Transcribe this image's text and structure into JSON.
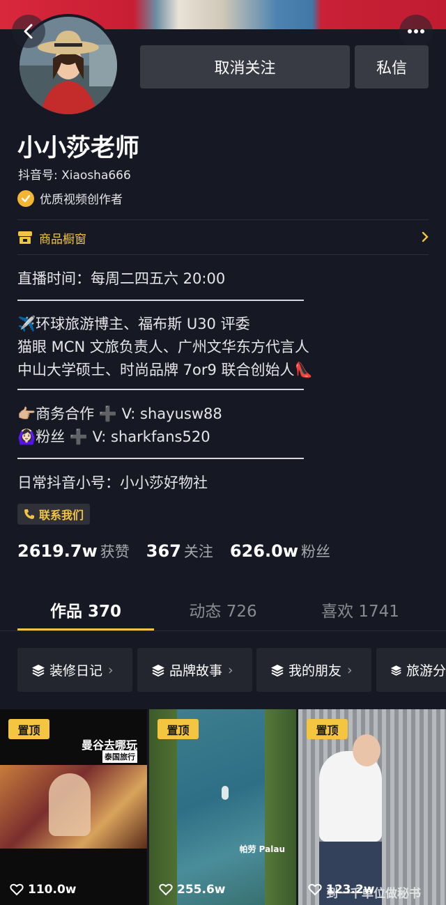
{
  "nav": {
    "back_icon": "back-icon",
    "more_icon": "more-icon"
  },
  "profile": {
    "unfollow_label": "取消关注",
    "message_label": "私信",
    "name": "小小莎老师",
    "douyin_id": "抖音号: Xiaosha666",
    "verified_label": "优质视频创作者",
    "shop_label": "商品橱窗",
    "bio": {
      "live_time": "直播时间：每周二四五六 20:00",
      "line1": "✈️环球旅游博主、福布斯 U30 评委",
      "line2": "猫眼 MCN 文旅负责人、广州文华东方代言人",
      "line3": "中山大学硕士、时尚品牌 7or9 联合创始人👠",
      "business": "👉🏼商务合作 ➕ V:  shayusw88",
      "fans": "🙆🏻‍♀️粉丝 ➕ V:  sharkfans520",
      "alt_account": "日常抖音小号：小小莎好物社"
    },
    "contact_label": "联系我们",
    "stats": [
      {
        "value": "2619.7w",
        "label": "获赞"
      },
      {
        "value": "367",
        "label": "关注"
      },
      {
        "value": "626.0w",
        "label": "粉丝"
      }
    ]
  },
  "tabs": [
    {
      "label": "作品 370"
    },
    {
      "label": "动态 726"
    },
    {
      "label": "喜欢 1741"
    }
  ],
  "collections": [
    {
      "label": "装修日记"
    },
    {
      "label": "品牌故事"
    },
    {
      "label": "我的朋友"
    },
    {
      "label": "旅游分"
    }
  ],
  "videos": [
    {
      "pin": "置顶",
      "likes": "110.0w",
      "title": "曼谷去哪玩",
      "subtitle": "泰国旅行"
    },
    {
      "pin": "置顶",
      "likes": "255.6w",
      "caption": "帕劳 Palau"
    },
    {
      "pin": "置顶",
      "likes": "123.2w",
      "caption": "到一千单位做秘书"
    }
  ],
  "colors": {
    "background": "#161823",
    "accent_yellow": "#f2c443",
    "button": "#393b44"
  }
}
